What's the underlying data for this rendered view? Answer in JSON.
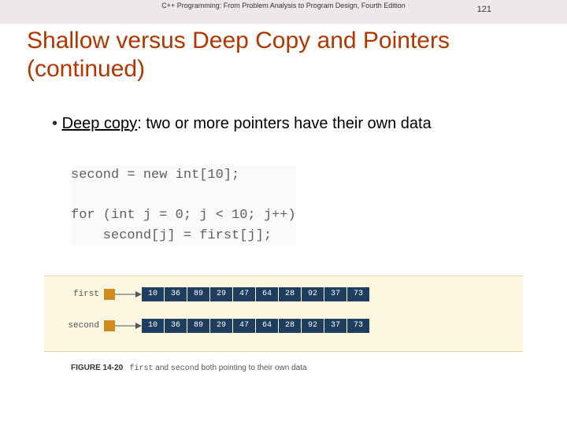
{
  "header": {
    "book": "C++ Programming: From Problem Analysis to Program Design, Fourth Edition",
    "page": "121"
  },
  "title": "Shallow versus Deep Copy and Pointers (continued)",
  "bullet": {
    "term": "Deep copy",
    "rest": ": two or more pointers have their own data"
  },
  "code": {
    "line1": "second = new int[10];",
    "line2": "",
    "line3": "for (int j = 0; j < 10; j++)",
    "line4": "    second[j] = first[j];"
  },
  "figure": {
    "labels": {
      "first": "first",
      "second": "second"
    },
    "values": [
      "10",
      "36",
      "89",
      "29",
      "47",
      "64",
      "28",
      "92",
      "37",
      "73"
    ],
    "caption_label": "FIGURE 14-20",
    "caption_body_a": "first",
    "caption_body_mid": " and ",
    "caption_body_b": "second",
    "caption_body_end": " both pointing to their own data"
  }
}
